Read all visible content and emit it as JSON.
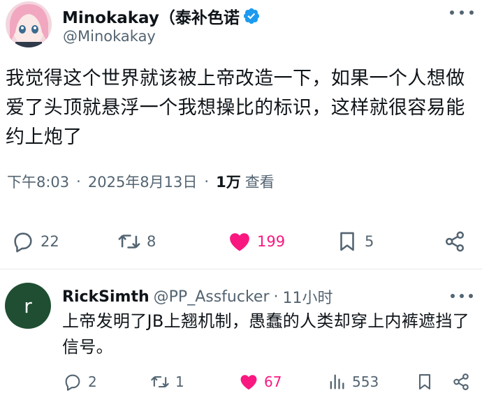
{
  "post": {
    "author_name": "Minokakay（泰补色诺",
    "author_handle": "@Minokakay",
    "text": "我觉得这个世界就该被上帝改造一下，如果一个人想做爱了头顶就悬浮一个我想操比的标识，这样就很容易能约上炮了",
    "time": "下午8:03",
    "date": "2025年8月13日",
    "views": "1万",
    "views_label": "查看",
    "separator": "·",
    "replies": "22",
    "reposts": "8",
    "likes": "199",
    "bookmarks": "5"
  },
  "reply": {
    "avatar_letter": "r",
    "name": "RickSimth",
    "handle": "@PP_Assfucker",
    "separator": "·",
    "time": "11小时",
    "text": "上帝发明了JB上翘机制，愚蠢的人类却穿上内裤遮挡了信号。",
    "replies": "2",
    "reposts": "1",
    "likes": "67",
    "views": "553"
  },
  "colors": {
    "text_primary": "#0f1419",
    "text_secondary": "#536471",
    "like": "#f91880",
    "verified": "#1d9bf0",
    "reply_avatar_bg": "#1f4e32"
  },
  "icons": [
    "reply-icon",
    "repost-icon",
    "heart-icon",
    "bookmark-icon",
    "share-icon",
    "views-icon",
    "verified-badge-icon",
    "more-icon"
  ]
}
